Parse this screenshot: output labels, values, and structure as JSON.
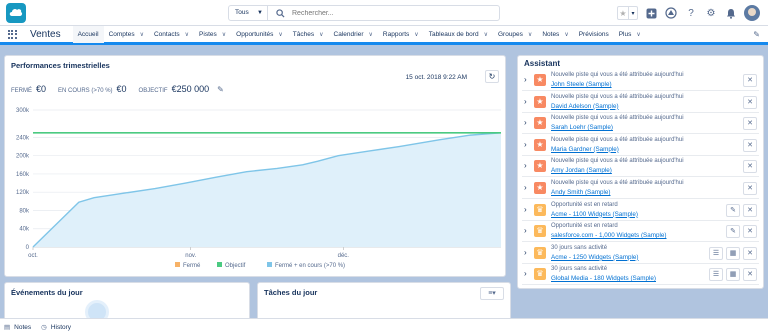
{
  "header": {
    "scope_label": "Tous",
    "search_placeholder": "Rechercher...",
    "icons": [
      "salesforce-logo",
      "star-icon",
      "add-icon",
      "trailhead-icon",
      "help-icon",
      "setup-gear-icon",
      "notifications-bell-icon",
      "user-avatar"
    ]
  },
  "nav": {
    "app_name": "Ventes",
    "items": [
      {
        "label": "Accueil",
        "active": true,
        "dropdown": false
      },
      {
        "label": "Comptes",
        "dropdown": true
      },
      {
        "label": "Contacts",
        "dropdown": true
      },
      {
        "label": "Pistes",
        "dropdown": true
      },
      {
        "label": "Opportunités",
        "dropdown": true
      },
      {
        "label": "Tâches",
        "dropdown": true
      },
      {
        "label": "Calendrier",
        "dropdown": true
      },
      {
        "label": "Rapports",
        "dropdown": true
      },
      {
        "label": "Tableaux de bord",
        "dropdown": true
      },
      {
        "label": "Groupes",
        "dropdown": true
      },
      {
        "label": "Notes",
        "dropdown": true
      },
      {
        "label": "Prévisions",
        "dropdown": false
      },
      {
        "label": "Plus",
        "dropdown": true
      }
    ]
  },
  "performance": {
    "title": "Performances trimestrielles",
    "date": "15 oct. 2018 9:22 AM",
    "closed_label": "FERMÉ",
    "closed_value": "€0",
    "open_label": "EN COURS (>70 %)",
    "open_value": "€0",
    "goal_label": "OBJECTIF",
    "goal_value": "€250 000"
  },
  "chart_data": {
    "type": "line",
    "x_ticks": [
      "oct.",
      "nov.",
      "déc."
    ],
    "y_ticks": [
      "0",
      "40k",
      "80k",
      "120k",
      "160k",
      "200k",
      "240k",
      "300k"
    ],
    "ylim": [
      0,
      300000
    ],
    "legend": [
      "Fermé",
      "Objectif",
      "Fermé + en cours (>70 %)"
    ],
    "legend_position": "bottom",
    "colors": {
      "closed": "#f7b267",
      "goal": "#4bca81",
      "closed_open": "#7fc5e8"
    },
    "x_range_days": [
      0,
      92
    ],
    "series": [
      {
        "name": "Objectif",
        "x": [
          0,
          92
        ],
        "y": [
          250000,
          250000
        ]
      },
      {
        "name": "Fermé + en cours (>70 %)",
        "x": [
          0,
          9,
          12,
          18,
          24,
          30,
          36,
          42,
          48,
          53,
          56,
          60,
          66,
          72,
          80,
          86,
          92
        ],
        "y": [
          0,
          98000,
          108000,
          118000,
          128000,
          140000,
          153000,
          165000,
          172000,
          180000,
          188000,
          200000,
          210000,
          220000,
          235000,
          245000,
          250000
        ]
      }
    ]
  },
  "assistant": {
    "title": "Assistant",
    "items": [
      {
        "type": "lead",
        "text": "Nouvelle piste qui vous a été attribuée aujourd'hui",
        "link": "John Steele (Sample)",
        "actions": [
          "close"
        ]
      },
      {
        "type": "lead",
        "text": "Nouvelle piste qui vous a été attribuée aujourd'hui",
        "link": "David Adelson (Sample)",
        "actions": [
          "close"
        ]
      },
      {
        "type": "lead",
        "text": "Nouvelle piste qui vous a été attribuée aujourd'hui",
        "link": "Sarah Loehr (Sample)",
        "actions": [
          "close"
        ]
      },
      {
        "type": "lead",
        "text": "Nouvelle piste qui vous a été attribuée aujourd'hui",
        "link": "Maria Gardner (Sample)",
        "actions": [
          "close"
        ]
      },
      {
        "type": "lead",
        "text": "Nouvelle piste qui vous a été attribuée aujourd'hui",
        "link": "Amy Jordan (Sample)",
        "actions": [
          "close"
        ]
      },
      {
        "type": "lead",
        "text": "Nouvelle piste qui vous a été attribuée aujourd'hui",
        "link": "Andy Smith (Sample)",
        "actions": [
          "close"
        ]
      },
      {
        "type": "opp",
        "text": "Opportunité est en retard",
        "link": "Acme - 1100 Widgets (Sample)",
        "actions": [
          "edit",
          "close"
        ]
      },
      {
        "type": "opp",
        "text": "Opportunité est en retard",
        "link": "salesforce.com - 1,000 Widgets (Sample)",
        "actions": [
          "edit",
          "close"
        ]
      },
      {
        "type": "opp",
        "text": "30 jours sans activité",
        "link": "Acme - 1250 Widgets (Sample)",
        "actions": [
          "task",
          "event",
          "close"
        ]
      },
      {
        "type": "opp",
        "text": "30 jours sans activité",
        "link": "Global Media - 180 Widgets (Sample)",
        "actions": [
          "task",
          "event",
          "close"
        ]
      }
    ]
  },
  "events": {
    "title": "Événements du jour"
  },
  "tasks": {
    "title": "Tâches du jour"
  },
  "utility_bar": {
    "notes_label": "Notes",
    "history_label": "History"
  }
}
